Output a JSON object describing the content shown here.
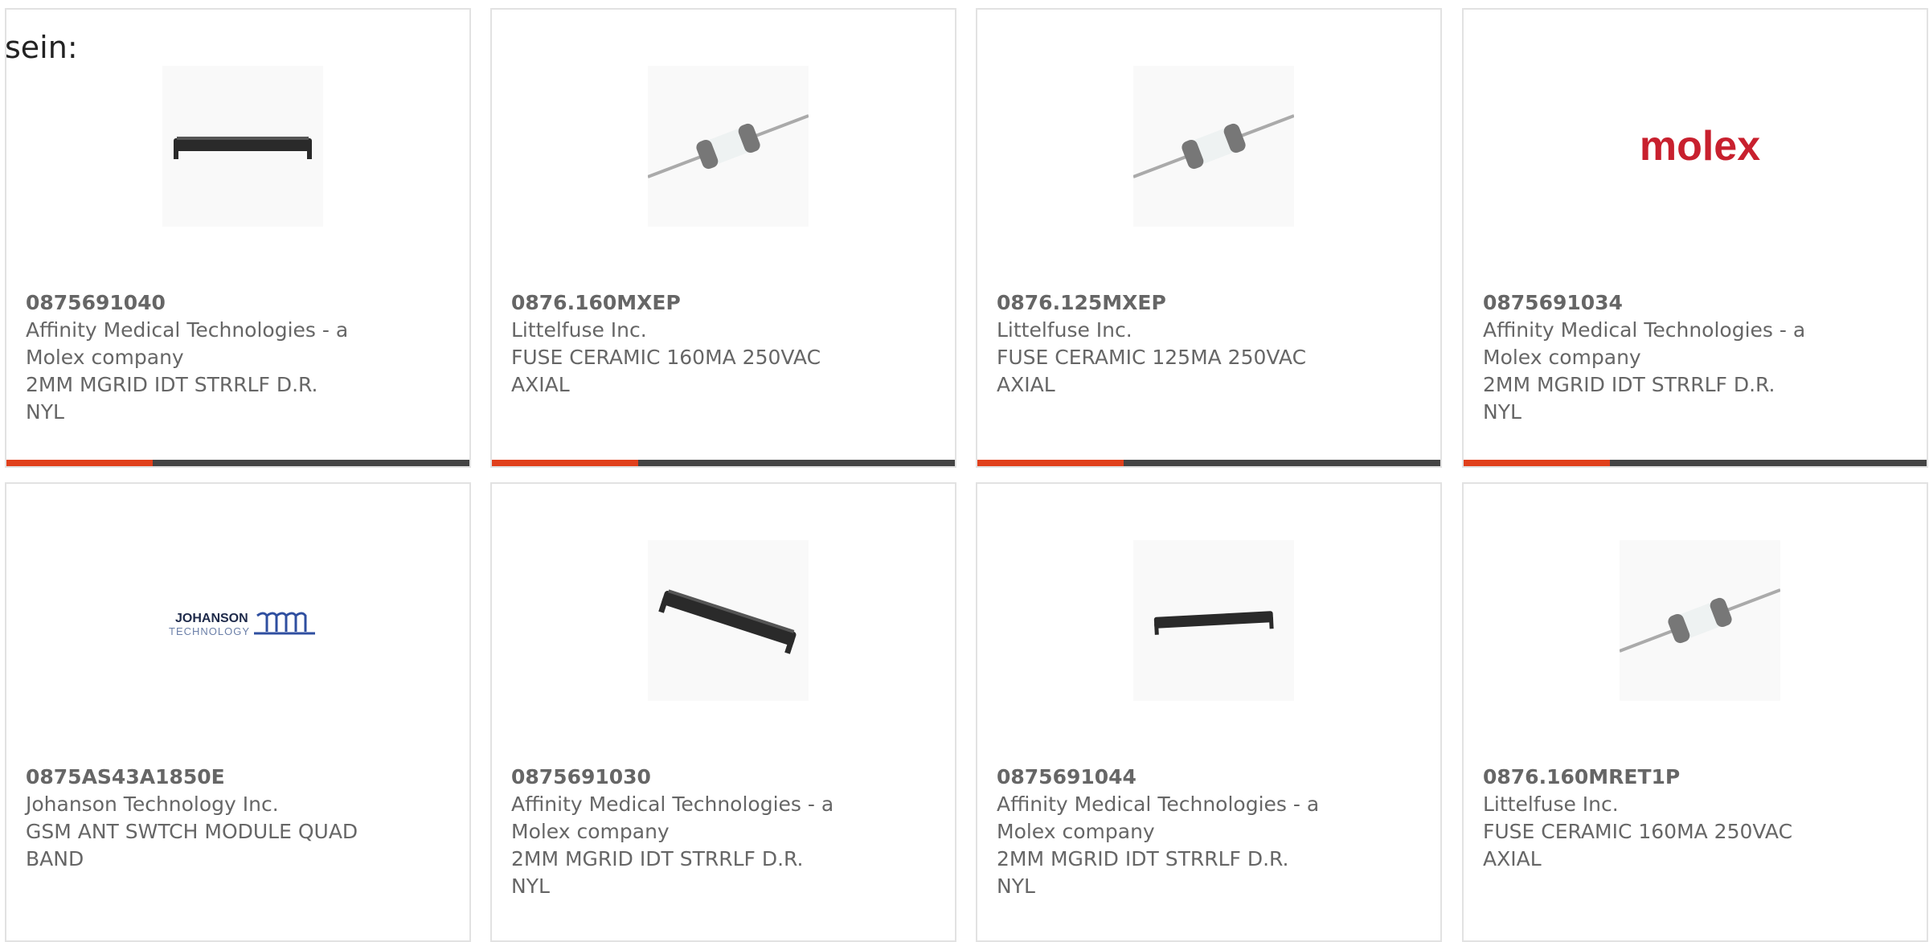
{
  "lead_text": "sein:",
  "accent_color": "#e0401c",
  "bar_color": "#444444",
  "cards": [
    {
      "part_number": "0875691040",
      "manufacturer_line1": "Affinity Medical Technologies - a",
      "manufacturer_line2": "Molex company",
      "desc_line1": "2MM MGRID IDT STRRLF D.R.",
      "desc_line2": "NYL",
      "image": "black-connector"
    },
    {
      "part_number": "0876.160MXEP",
      "manufacturer_line1": "Littelfuse Inc.",
      "manufacturer_line2": "",
      "desc_line1": "FUSE CERAMIC 160MA 250VAC",
      "desc_line2": "AXIAL",
      "image": "axial-fuse"
    },
    {
      "part_number": "0876.125MXEP",
      "manufacturer_line1": "Littelfuse Inc.",
      "manufacturer_line2": "",
      "desc_line1": "FUSE CERAMIC 125MA 250VAC",
      "desc_line2": "AXIAL",
      "image": "axial-fuse"
    },
    {
      "part_number": "0875691034",
      "manufacturer_line1": "Affinity Medical Technologies - a",
      "manufacturer_line2": "Molex company",
      "desc_line1": "2MM MGRID IDT STRRLF D.R.",
      "desc_line2": "NYL",
      "image": "molex-logo",
      "logo_text": "molex"
    },
    {
      "part_number": "0875AS43A1850E",
      "manufacturer_line1": "Johanson Technology Inc.",
      "manufacturer_line2": "",
      "desc_line1": "GSM ANT SWTCH MODULE QUAD",
      "desc_line2": "BAND",
      "image": "johanson-logo",
      "logo_text": "JOHANSON",
      "logo_subtext": "TECHNOLOGY"
    },
    {
      "part_number": "0875691030",
      "manufacturer_line1": "Affinity Medical Technologies - a",
      "manufacturer_line2": "Molex company",
      "desc_line1": "2MM MGRID IDT STRRLF D.R.",
      "desc_line2": "NYL",
      "image": "black-connector"
    },
    {
      "part_number": "0875691044",
      "manufacturer_line1": "Affinity Medical Technologies - a",
      "manufacturer_line2": "Molex company",
      "desc_line1": "2MM MGRID IDT STRRLF D.R.",
      "desc_line2": "NYL",
      "image": "black-connector"
    },
    {
      "part_number": "0876.160MRET1P",
      "manufacturer_line1": "Littelfuse Inc.",
      "manufacturer_line2": "",
      "desc_line1": "FUSE CERAMIC 160MA 250VAC",
      "desc_line2": "AXIAL",
      "image": "axial-fuse"
    }
  ]
}
